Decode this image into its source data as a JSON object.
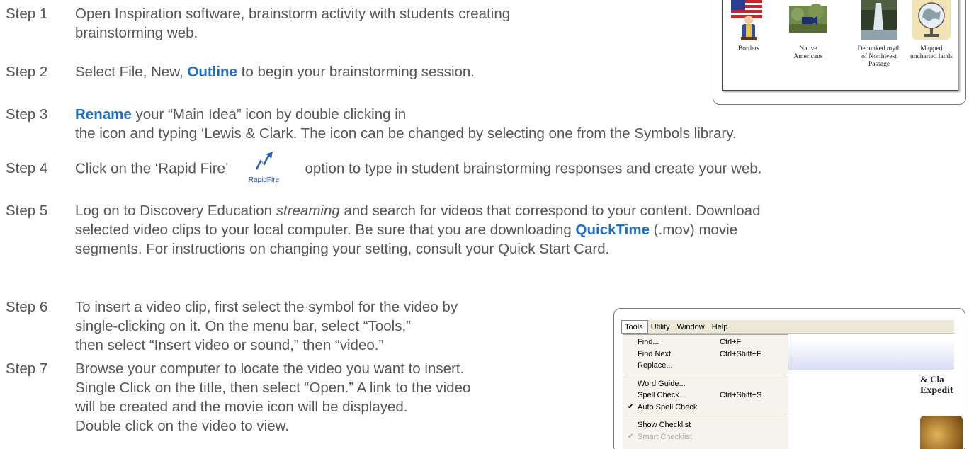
{
  "steps": [
    {
      "label": "Step 1",
      "line1": "Open Inspiration software, brainstorm activity with students creating",
      "line2": "brainstorming web."
    },
    {
      "label": "Step 2",
      "before": "Select File, New, ",
      "keyword": "Outline",
      "after": " to begin your brainstorming session."
    },
    {
      "label": "Step 3",
      "keyword": "Rename",
      "line1_after": " your “Main Idea” icon by double clicking in",
      "line2": "the icon and typing ‘Lewis & Clark.  The icon can be changed by selecting one from the Symbols library."
    },
    {
      "label": "Step 4",
      "before": "Click on the ‘Rapid Fire’",
      "icon_caption": "RapidFire",
      "after": "option to type in student brainstorming responses and create your web."
    },
    {
      "label": "Step 5",
      "line1_before": "Log on to Discovery Education ",
      "line1_italic": "streaming",
      "line1_after": " and search for videos that correspond to your content. Download",
      "line2_before": "selected video clips to your local computer.  Be sure that you are downloading ",
      "line2_keyword": "QuickTime",
      "line2_after": " (.mov) movie",
      "line3": "segments. For instructions on changing your setting, consult your Quick Start Card."
    },
    {
      "label": "Step 6",
      "line1": "To insert a video clip, first select the symbol for the video by",
      "line2": "single-clicking on it.  On the menu bar, select “Tools,”",
      "line3": "then select “Insert video or sound,” then “video.”"
    },
    {
      "label": "Step 7",
      "line1": "Browse your computer to locate the video you want to insert.",
      "line2": "Single Click on the title, then select “Open.”  A link to the video",
      "line3": "will be created and the movie icon will be displayed.",
      "line4": "Double click on the video to view."
    }
  ],
  "symbols_panel": {
    "symbols": [
      {
        "caption": "Borders",
        "icon": "flag-figure-icon"
      },
      {
        "caption": "Native Americans",
        "icon": "video-clip-icon"
      },
      {
        "caption": "Debunked myth of Northwest Passage",
        "icon": "waterfall-icon"
      },
      {
        "caption": "Mapped uncharted lands",
        "icon": "globe-icon"
      }
    ]
  },
  "menu_panel": {
    "menubar": [
      "Tools",
      "Utility",
      "Window",
      "Help"
    ],
    "items": [
      {
        "label": "Find...",
        "shortcut": "Ctrl+F"
      },
      {
        "label": "Find Next",
        "shortcut": "Ctrl+Shift+F"
      },
      {
        "label": "Replace...",
        "shortcut": ""
      },
      {
        "label": "Word Guide...",
        "shortcut": ""
      },
      {
        "label": "Spell Check...",
        "shortcut": "Ctrl+Shift+S"
      },
      {
        "label": "Auto Spell Check",
        "shortcut": "",
        "checked": true
      },
      {
        "label": "Show Checklist",
        "shortcut": ""
      },
      {
        "label": "Smart Checklist",
        "shortcut": "",
        "checked": true,
        "disabled": true
      }
    ],
    "doc_text1": "& Cla",
    "doc_text2": "Expedit"
  },
  "colors": {
    "keyword": "#1f6fc0",
    "body_text": "#555555"
  }
}
